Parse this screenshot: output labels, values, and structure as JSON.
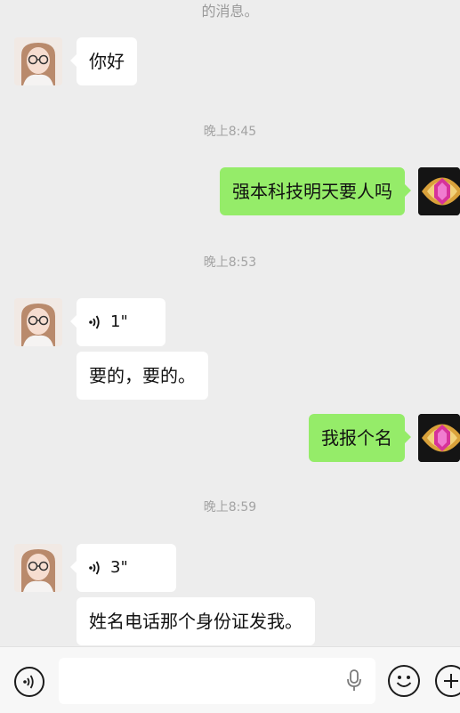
{
  "system_message_tail": "的消息。",
  "timestamps": [
    "晚上8:45",
    "晚上8:53",
    "晚上8:59"
  ],
  "messages": [
    {
      "side": "left",
      "type": "text",
      "text": "你好"
    },
    {
      "side": "right",
      "type": "text",
      "text": "强本科技明天要人吗"
    },
    {
      "side": "left",
      "type": "voice",
      "duration": "1\""
    },
    {
      "side": "left",
      "type": "text",
      "text": "要的，要的。"
    },
    {
      "side": "right",
      "type": "text",
      "text": "我报个名"
    },
    {
      "side": "left",
      "type": "voice",
      "duration": "3\""
    },
    {
      "side": "left",
      "type": "text",
      "text": "姓名电话那个身份证发我。"
    }
  ],
  "input": {
    "value": "",
    "placeholder": ""
  },
  "icons": {
    "voice_toggle": "voice-mode-icon",
    "microphone": "microphone-icon",
    "emoji": "emoji-icon",
    "plus": "plus-icon"
  },
  "colors": {
    "chat_background": "#ededed",
    "outgoing_bubble": "#95ec69",
    "incoming_bubble": "#ffffff"
  }
}
